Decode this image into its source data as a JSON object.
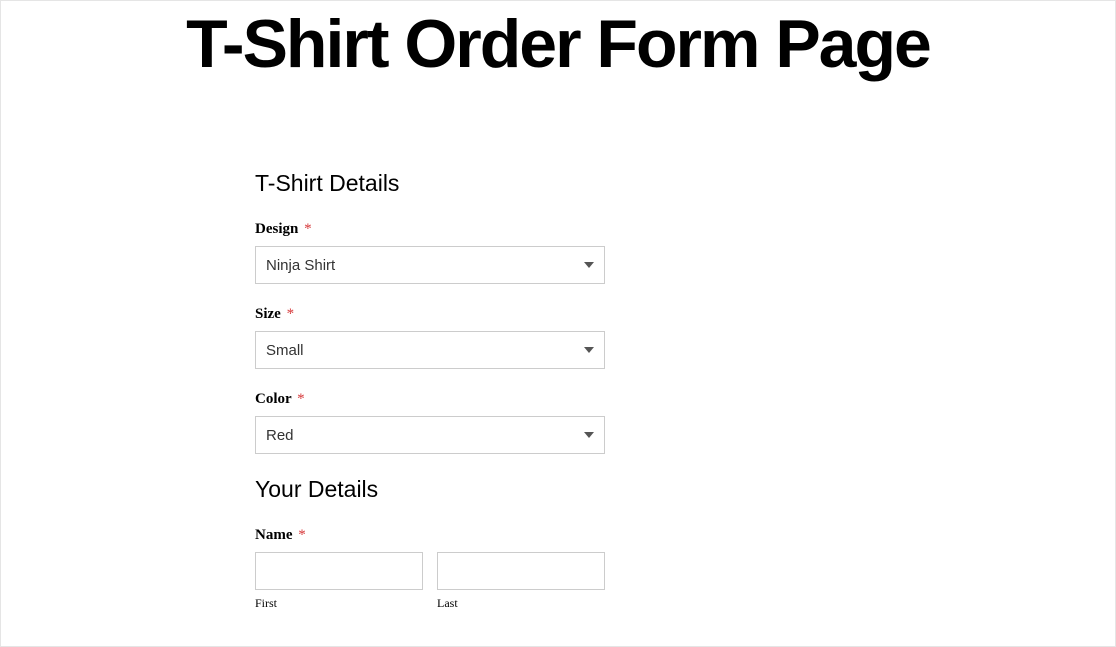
{
  "page": {
    "title": "T-Shirt Order Form Page"
  },
  "sections": {
    "tshirt": {
      "heading": "T-Shirt Details"
    },
    "your": {
      "heading": "Your Details"
    }
  },
  "fields": {
    "design": {
      "label": "Design",
      "required": "*",
      "value": "Ninja Shirt"
    },
    "size": {
      "label": "Size",
      "required": "*",
      "value": "Small"
    },
    "color": {
      "label": "Color",
      "required": "*",
      "value": "Red"
    },
    "name": {
      "label": "Name",
      "required": "*",
      "first_sublabel": "First",
      "last_sublabel": "Last",
      "first_value": "",
      "last_value": ""
    }
  }
}
